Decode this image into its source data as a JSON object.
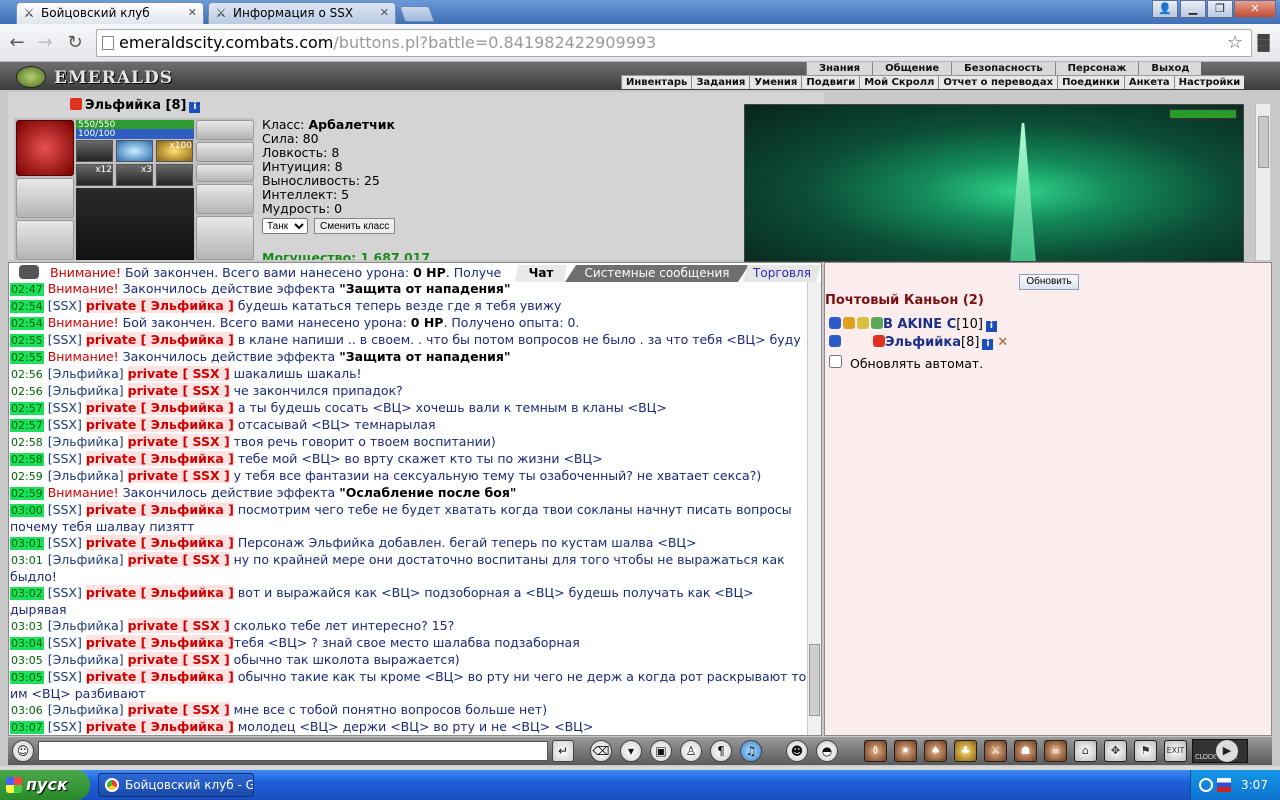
{
  "browser": {
    "tabs": [
      {
        "title": "Бойцовский клуб"
      },
      {
        "title": "Информация о SSX"
      }
    ],
    "url_host": "emeraldscity.combats.com",
    "url_path": "/buttons.pl?battle=0.841982422909993"
  },
  "site": {
    "logo": "EMERALDS",
    "topnav": [
      "Знания",
      "Общение",
      "Безопасность",
      "Персонаж",
      "Выход"
    ],
    "subnav": [
      "Инвентарь",
      "Задания",
      "Умения",
      "Подвиги",
      "Мой Скролл",
      "Отчет о переводах",
      "Поединки",
      "Анкета",
      "Настройки"
    ]
  },
  "character": {
    "name": "Эльфийка",
    "level": "[8]",
    "hp": "550/550",
    "mp": "100/100",
    "buffs": [
      "",
      "",
      "x100",
      "x12",
      "x3",
      ""
    ],
    "class_label": "Класс:",
    "class_value": "Арбалетчик",
    "stats": [
      "Сила: 80",
      "Ловкость: 8",
      "Интуиция: 8",
      "Выносливость: 25",
      "Интеллект: 5",
      "Мудрость: 0"
    ],
    "role_selected": "Танк",
    "change_class_label": "Сменить класс",
    "power": "Могущество: 1 687 017"
  },
  "chat": {
    "tabs": [
      "Чат",
      "Системные сообщения",
      "Торговля"
    ],
    "first_line": {
      "warn": "Внимание!",
      "text": " Бой закончен. Всего вами нанесено урона: ",
      "bold": "0 HP",
      "rest": ". Получе"
    },
    "lines": [
      {
        "time": "02:47",
        "tsg": true,
        "type": "warn",
        "warn": "Внимание!",
        "text": " Закончилось действие эффекта ",
        "bold": "\"Защита от нападения\"",
        "rest": ""
      },
      {
        "time": "02:54",
        "tsg": true,
        "type": "pm",
        "from": "[SSX]",
        "to": "private [ Эльфийка ]",
        "text": " будешь кататься теперь везде где я тебя увижу"
      },
      {
        "time": "02:54",
        "tsg": true,
        "type": "warn",
        "warn": "Внимание!",
        "text": " Бой закончен. Всего вами нанесено урона: ",
        "bold": "0 HP",
        "rest": ". Получено опыта: 0."
      },
      {
        "time": "02:55",
        "tsg": true,
        "type": "pm",
        "from": "[SSX]",
        "to": "private [ Эльфийка ]",
        "text": " в клане напиши .. в своем. . что бы потом вопросов не было . за что тебя <ВЦ> буду"
      },
      {
        "time": "02:55",
        "tsg": true,
        "type": "warn",
        "warn": "Внимание!",
        "text": " Закончилось действие эффекта ",
        "bold": "\"Защита от нападения\"",
        "rest": ""
      },
      {
        "time": "02:56",
        "tsg": false,
        "type": "pm",
        "from": "[Эльфийка]",
        "to": "private [ SSX ]",
        "text": " шакалишь шакаль!"
      },
      {
        "time": "02:56",
        "tsg": false,
        "type": "pm",
        "from": "[Эльфийка]",
        "to": "private [ SSX ]",
        "text": " че закончился припадок?"
      },
      {
        "time": "02:57",
        "tsg": true,
        "type": "pm",
        "from": "[SSX]",
        "to": "private [ Эльфийка ]",
        "text": " а ты будешь сосать <ВЦ> хочешь вали к темным в кланы <ВЦ>"
      },
      {
        "time": "02:57",
        "tsg": true,
        "type": "pm",
        "from": "[SSX]",
        "to": "private [ Эльфийка ]",
        "text": " отсасывай <ВЦ> темнарылая"
      },
      {
        "time": "02:58",
        "tsg": false,
        "type": "pm",
        "from": "[Эльфийка]",
        "to": "private [ SSX ]",
        "text": " твоя речь говорит о твоем воспитании)"
      },
      {
        "time": "02:58",
        "tsg": true,
        "type": "pm",
        "from": "[SSX]",
        "to": "private [ Эльфийка ]",
        "text": " тебе мой <ВЦ> во врту скажет кто ты по жизни <ВЦ>"
      },
      {
        "time": "02:59",
        "tsg": false,
        "type": "pm",
        "from": "[Эльфийка]",
        "to": "private [ SSX ]",
        "text": " у тебя все фантазии на сексуальную тему ты озабоченный? не хватает секса?)"
      },
      {
        "time": "02:59",
        "tsg": true,
        "type": "warn",
        "warn": "Внимание!",
        "text": " Закончилось действие эффекта ",
        "bold": "\"Ослабление после боя\"",
        "rest": ""
      },
      {
        "time": "03:00",
        "tsg": true,
        "type": "pm",
        "from": "[SSX]",
        "to": "private [ Эльфийка ]",
        "text": " посмотрим чего тебе не будет хватать когда твои сокланы начнут писать вопросы почему тебя шалвау пизятт"
      },
      {
        "time": "03:01",
        "tsg": true,
        "type": "pm",
        "from": "[SSX]",
        "to": "private [ Эльфийка ]",
        "text": " Персонаж Эльфийка добавлен. бегай теперь по кустам шалва <ВЦ>"
      },
      {
        "time": "03:01",
        "tsg": false,
        "type": "pm",
        "from": "[Эльфийка]",
        "to": "private [ SSX ]",
        "text": " ну по крайней мере они достаточно воспитаны для того чтобы не выражаться как быдло!"
      },
      {
        "time": "03:02",
        "tsg": true,
        "type": "pm",
        "from": "[SSX]",
        "to": "private [ Эльфийка ]",
        "text": " вот и выражайся как <ВЦ> подзоборная а <ВЦ> будешь получать как <ВЦ> дырявая"
      },
      {
        "time": "03:03",
        "tsg": false,
        "type": "pm",
        "from": "[Эльфийка]",
        "to": "private [ SSX ]",
        "text": " сколько тебе лет интересно? 15?"
      },
      {
        "time": "03:04",
        "tsg": true,
        "type": "pm",
        "from": "[SSX]",
        "to": "private [ Эльфийка ]",
        "text": "тебя <ВЦ> ? знай свое место шалабва подзаборная"
      },
      {
        "time": "03:05",
        "tsg": false,
        "type": "pm",
        "from": "[Эльфийка]",
        "to": "private [ SSX ]",
        "text": " обычно так школота выражается)"
      },
      {
        "time": "03:05",
        "tsg": true,
        "type": "pm",
        "from": "[SSX]",
        "to": "private [ Эльфийка ]",
        "text": " обычно такие как ты кроме <ВЦ> во рту ни чего не держ а когда рот раскрывают то им <ВЦ> разбивают"
      },
      {
        "time": "03:06",
        "tsg": false,
        "type": "pm",
        "from": "[Эльфийка]",
        "to": "private [ SSX ]",
        "text": " мне все с тобой понятно вопросов больше нет)"
      },
      {
        "time": "03:07",
        "tsg": true,
        "type": "pm",
        "from": "[SSX]",
        "to": "private [ Эльфийка ]",
        "text": " молодец <ВЦ> держи <ВЦ> во рту и не <ВЦ> <ВЦ>"
      }
    ]
  },
  "location": {
    "refresh_label": "Обновить",
    "title": "Почтовый Каньон (2)",
    "players": [
      {
        "name": "B AKINE C",
        "level": "[10]"
      },
      {
        "name": "Эльфийка",
        "level": "[8]"
      }
    ],
    "auto_refresh_label": "Обновлять автомат."
  },
  "bottombar": {
    "clock_label": "CLOCK TIMER"
  },
  "taskbar": {
    "start_label": "пуск",
    "app_label": "Бойцовский клуб - G...",
    "time": "3:07"
  },
  "colors": {
    "timestamp_green": "#19e05d",
    "private_red": "#d10000",
    "nick_blue": "#1a3a7a"
  }
}
